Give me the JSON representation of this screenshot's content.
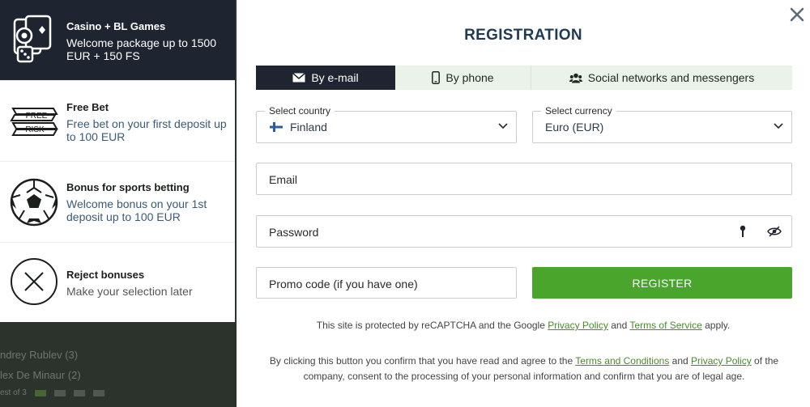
{
  "background": {
    "line1": "ndrey Rublev (3)",
    "line2": "lex De Minaur (2)",
    "line3": "est of 3"
  },
  "bonuses": [
    {
      "title": "Casino + BL Games",
      "desc": "Welcome package up to 1500 EUR + 150 FS",
      "icon": "casino-chips-icon"
    },
    {
      "title": "Free Bet",
      "desc": "Free bet on your first deposit up to 100 EUR",
      "icon": "free-risk-icon",
      "badge_top": "FREE",
      "badge_bottom": "RISK"
    },
    {
      "title": "Bonus for sports betting",
      "desc": "Welcome bonus on your 1st deposit up to 100 EUR",
      "icon": "soccer-ball-icon"
    },
    {
      "title": "Reject bonuses",
      "desc": "Make your selection later",
      "icon": "reject-x-icon"
    }
  ],
  "modal": {
    "title": "REGISTRATION",
    "tabs": [
      {
        "label": "By e-mail",
        "icon": "envelope-icon",
        "active": true
      },
      {
        "label": "By phone",
        "icon": "phone-icon",
        "active": false
      },
      {
        "label": "Social networks and messengers",
        "icon": "users-icon",
        "active": false
      }
    ],
    "country": {
      "label": "Select country",
      "value": "Finland"
    },
    "currency": {
      "label": "Select currency",
      "value": "Euro (EUR)"
    },
    "email": {
      "placeholder": "Email"
    },
    "password": {
      "placeholder": "Password"
    },
    "promo": {
      "placeholder": "Promo code (if you have one)"
    },
    "register_label": "REGISTER",
    "recaptcha": {
      "pre": "This site is protected by reCAPTCHA and the Google ",
      "privacy": "Privacy Policy",
      "and": " and ",
      "terms": "Terms of Service",
      "post": " apply."
    },
    "legal": {
      "pre": "By clicking this button you confirm that you have read and agree to the ",
      "terms": "Terms and Conditions",
      "and": " and ",
      "privacy": "Privacy Policy",
      "post": " of the company, consent to the processing of your personal information and confirm that you are of legal age."
    }
  },
  "colors": {
    "accent": "#4aa52c",
    "dark": "#1e2530",
    "title": "#1f3a55"
  }
}
